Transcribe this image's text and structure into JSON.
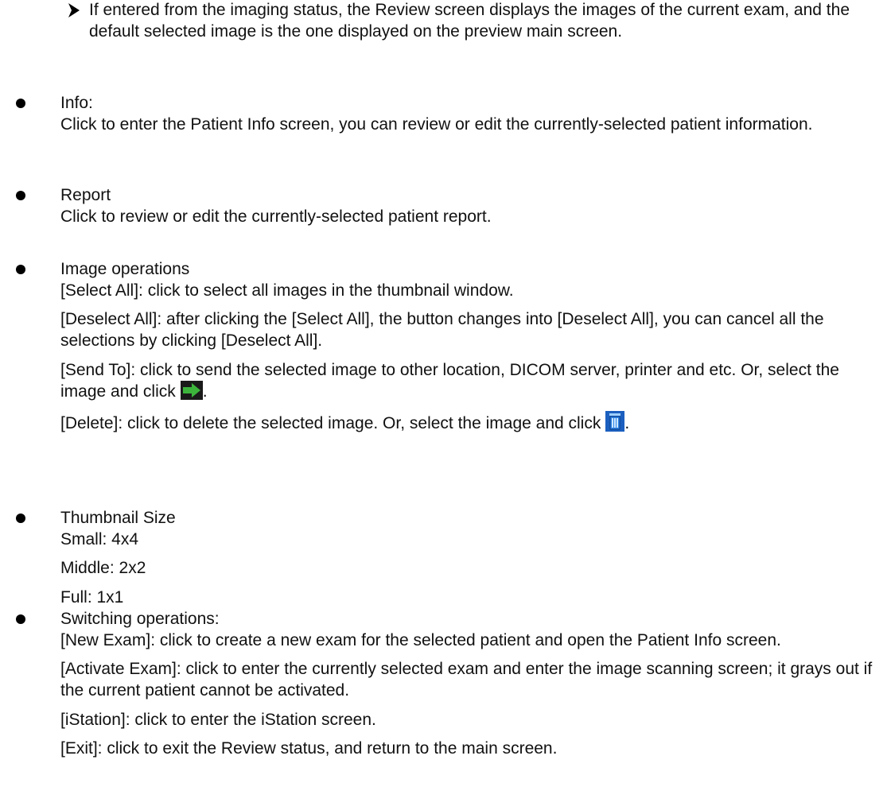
{
  "top_note": {
    "text": "If entered from the imaging status, the Review screen displays the images of the current exam, and the default selected image is the one displayed on the preview main screen."
  },
  "sections": {
    "info": {
      "title": "Info:",
      "body": "Click to enter the Patient Info screen, you can review or edit the currently-selected patient information."
    },
    "report": {
      "title": "Report",
      "body": "Click to review or edit the currently-selected patient report."
    },
    "image_operations": {
      "title": "Image operations",
      "select_all": "[Select All]: click to select all images in the thumbnail window.",
      "deselect_all": "[Deselect All]: after clicking the [Select All], the button changes into [Deselect All], you can cancel all the selections by clicking [Deselect All].",
      "send_to": "[Send To]: click to send the selected image to other location, DICOM server, printer and etc. Or, select the image and click",
      "send_to_end": ".",
      "send_icon": "green-arrow-icon",
      "delete": "[Delete]: click to delete the selected image. Or, select the image and click",
      "delete_end": ".",
      "delete_icon": "trash-icon"
    },
    "thumbnail_size": {
      "title": "Thumbnail Size",
      "small": "Small: 4x4",
      "middle": "Middle: 2x2",
      "full": "Full: 1x1"
    },
    "switching_operations": {
      "title": "Switching operations:",
      "new_exam": "[New Exam]: click to create a new exam for the selected patient and open the Patient Info screen.",
      "activate_exam": "[Activate Exam]: click to enter the currently selected exam and enter the image scanning screen; it grays out if the current patient cannot be activated.",
      "istation": "[iStation]: click to enter the iStation screen.",
      "exit": "[Exit]: click to exit the Review status, and return to the main screen."
    }
  },
  "colors": {
    "text": "#111111",
    "icon_arrow_green": "#3cb43c",
    "icon_trash_blue": "#1f6fd6"
  }
}
